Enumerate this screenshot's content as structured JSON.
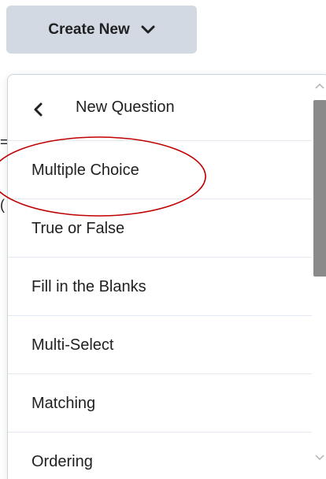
{
  "toolbar": {
    "create_label": "Create New"
  },
  "menu": {
    "header_title": "New Question",
    "items": [
      {
        "label": "Multiple Choice"
      },
      {
        "label": "True or False"
      },
      {
        "label": "Fill in the Blanks"
      },
      {
        "label": "Multi-Select"
      },
      {
        "label": "Matching"
      },
      {
        "label": "Ordering"
      }
    ]
  },
  "icons": {
    "create_dropdown": "chevron-down-icon",
    "back": "chevron-left-icon",
    "scroll_up": "chevron-up-icon",
    "scroll_down": "chevron-down-icon"
  },
  "colors": {
    "button_bg": "#d3d9e3",
    "text": "#202122",
    "divider": "#e3e9f1",
    "annotation": "#c00000",
    "scroll_thumb": "#8a8a8a"
  }
}
